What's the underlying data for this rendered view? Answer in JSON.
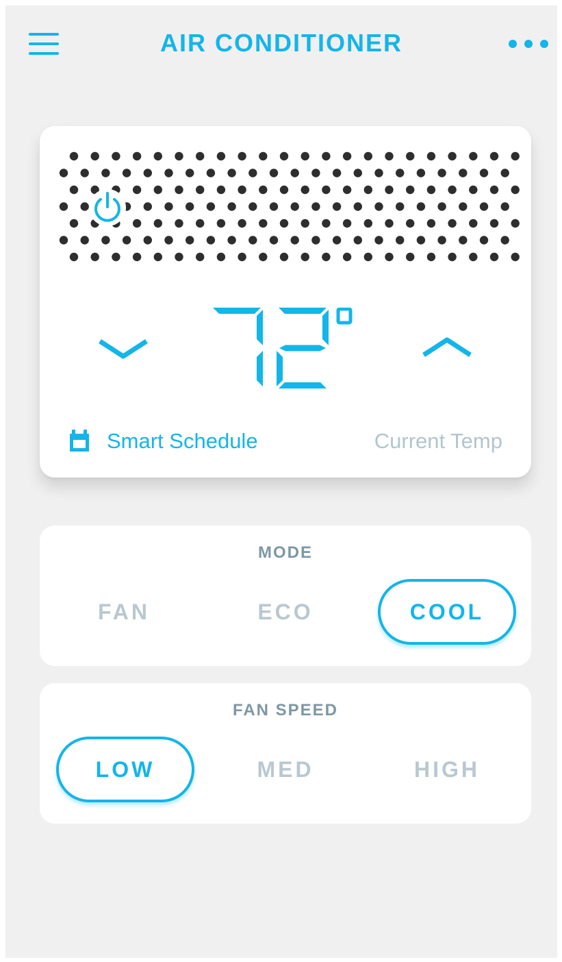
{
  "header": {
    "title": "AIR CONDITIONER",
    "menu_icon": "hamburger-menu-icon",
    "more_icon": "more-horizontal-icon"
  },
  "thermostat": {
    "temperature": "72",
    "degree_symbol": "°",
    "schedule_label": "Smart Schedule",
    "schedule_icon": "calendar-icon",
    "current_temp_label": "Current Temp",
    "power_icon": "power-icon"
  },
  "mode": {
    "title": "MODE",
    "options": [
      "FAN",
      "ECO",
      "COOL"
    ],
    "selected": "COOL"
  },
  "fan_speed": {
    "title": "FAN SPEED",
    "options": [
      "LOW",
      "MED",
      "HIGH"
    ],
    "selected": "LOW"
  },
  "colors": {
    "accent": "#13b5ea",
    "background": "#f0f0f0",
    "card": "#ffffff",
    "muted_text": "#b9c8d0",
    "grille_dots": "#2e2e2e"
  }
}
